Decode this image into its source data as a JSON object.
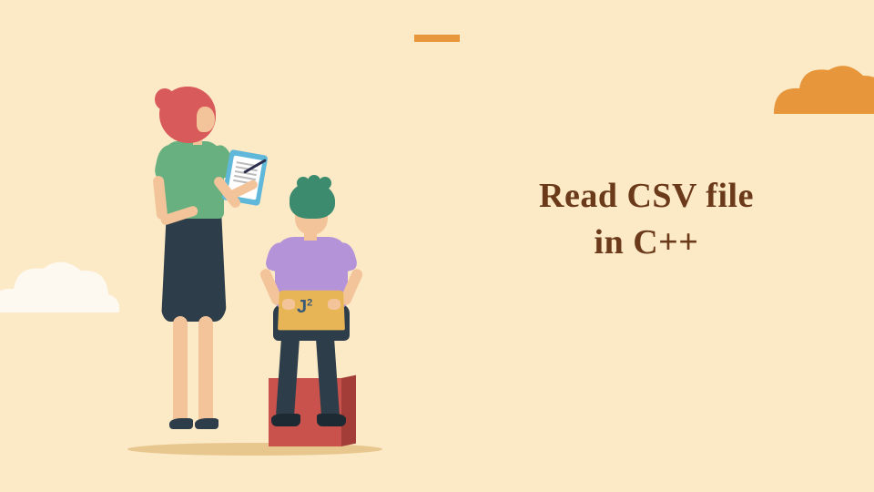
{
  "title_line1": "Read CSV file",
  "title_line2": "in C++",
  "laptop_logo": "J",
  "laptop_logo_sup": "2",
  "colors": {
    "background": "#fce9c5",
    "accent": "#e7963c",
    "title_text": "#6b3a1a",
    "cloud_orange": "#e7963c",
    "cloud_white": "#fdf9f0"
  }
}
